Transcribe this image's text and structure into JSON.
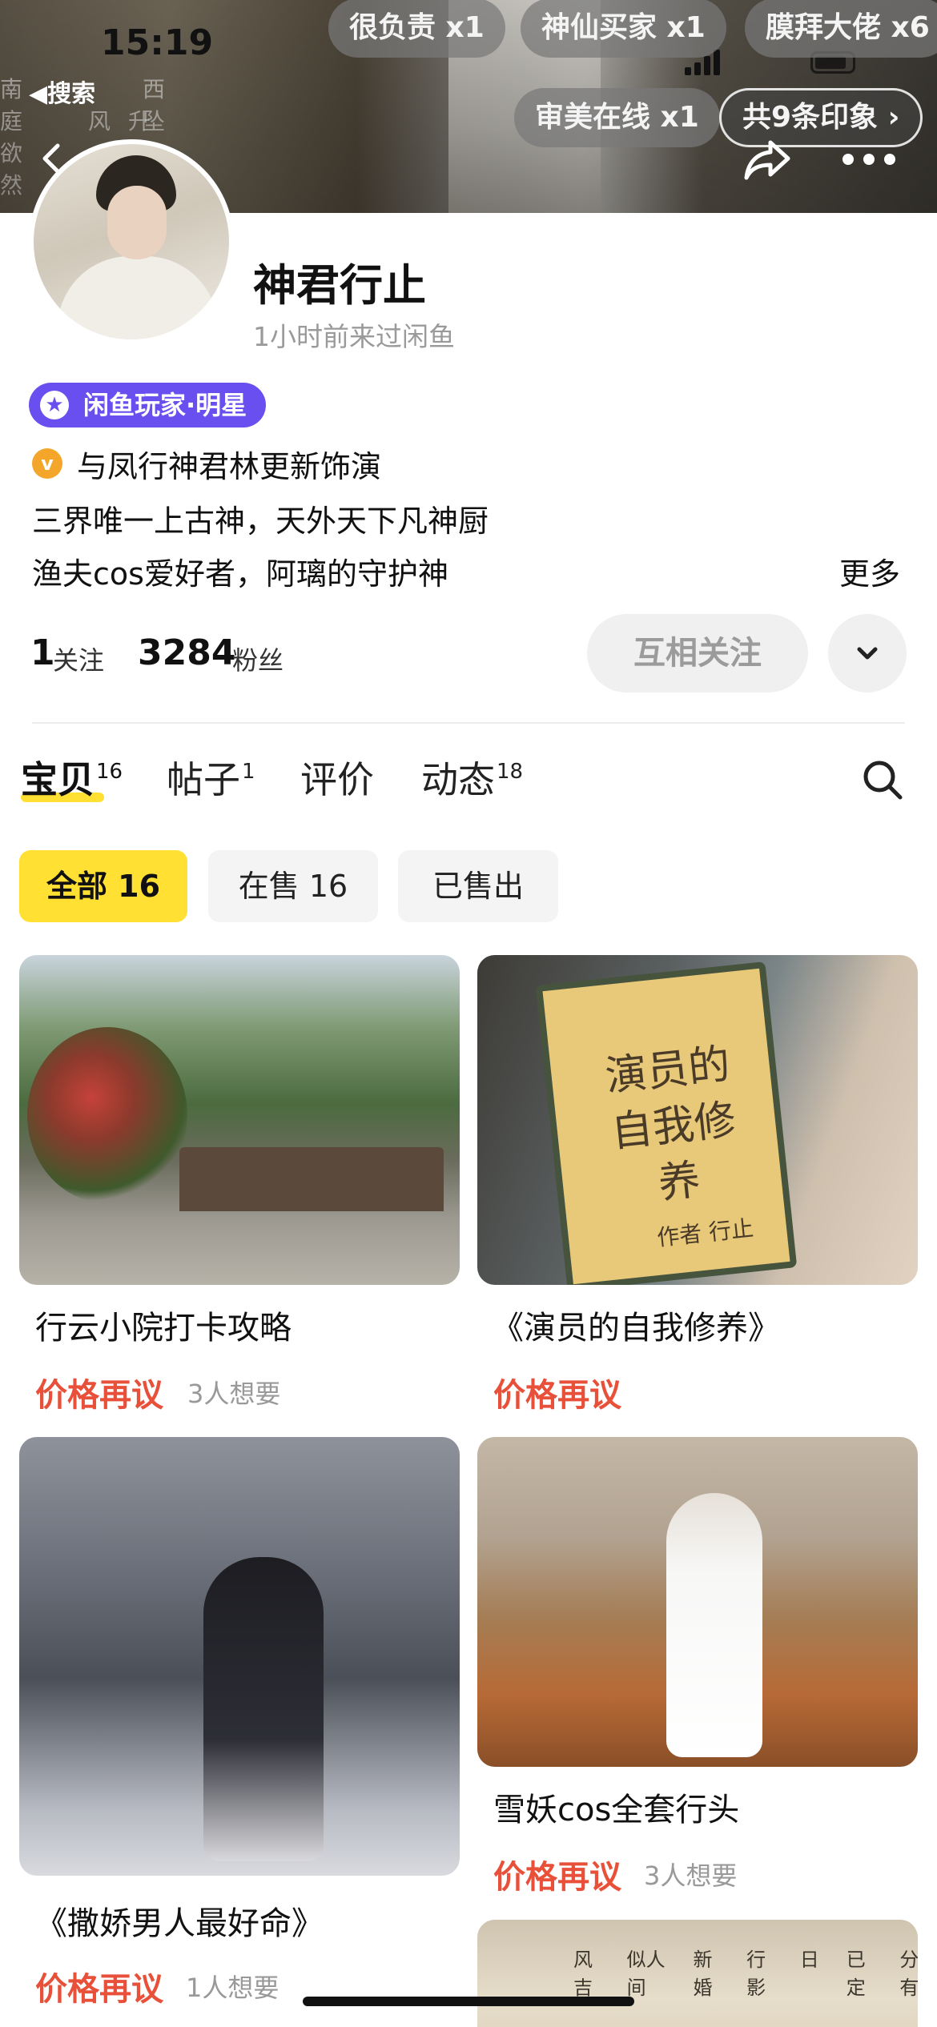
{
  "status_bar": {
    "time": "15:19",
    "back_app": "◀搜索"
  },
  "banner": {
    "poem_chars": [
      "南",
      "庭",
      "欲",
      "然",
      "风",
      "升",
      "西",
      "坠"
    ],
    "impression_tags": [
      {
        "label": "很负责 x1"
      },
      {
        "label": "神仙买家 x1"
      },
      {
        "label": "膜拜大佬 x6"
      },
      {
        "label": "审美在线 x1"
      }
    ],
    "all_impressions": "共9条印象 ›"
  },
  "profile": {
    "name": "神君行止",
    "last_seen": "1小时前来过闲鱼",
    "badge": "闲鱼玩家·明星",
    "verify_text": "与凤行神君林更新饰演",
    "bio_lines": [
      "三界唯一上古神，天外天下凡神厨",
      "渔夫cos爱好者，阿璃的守护神"
    ],
    "more": "更多",
    "following_count": "1",
    "following_label": "关注",
    "followers_count": "3284",
    "followers_label": "粉丝",
    "follow_button": "互相关注"
  },
  "tabs": [
    {
      "label": "宝贝",
      "count": "16"
    },
    {
      "label": "帖子",
      "count": "1"
    },
    {
      "label": "评价",
      "count": ""
    },
    {
      "label": "动态",
      "count": "18"
    }
  ],
  "filters": [
    "全部 16",
    "在售 16",
    "已售出"
  ],
  "products": [
    {
      "title": "行云小院打卡攻略",
      "price": "价格再议",
      "want": "3人想要"
    },
    {
      "title": "《演员的自我修养》",
      "price": "价格再议",
      "want": "",
      "book_title": "演员的自我修养",
      "book_author_label": "作者",
      "book_author": "行止"
    },
    {
      "title": "《撒娇男人最好命》",
      "price": "价格再议",
      "want": "1人想要"
    },
    {
      "title": "雪妖cos全套行头",
      "price": "价格再议",
      "want": "3人想要"
    }
  ],
  "scroll_poem_columns": [
    "风吉",
    "似人间",
    "新婚",
    "行影",
    "日",
    "已定",
    "分有"
  ],
  "colors": {
    "accent_yellow": "#ffe033",
    "price_red": "#e8503a",
    "badge_purple": "#6a4ff0"
  }
}
